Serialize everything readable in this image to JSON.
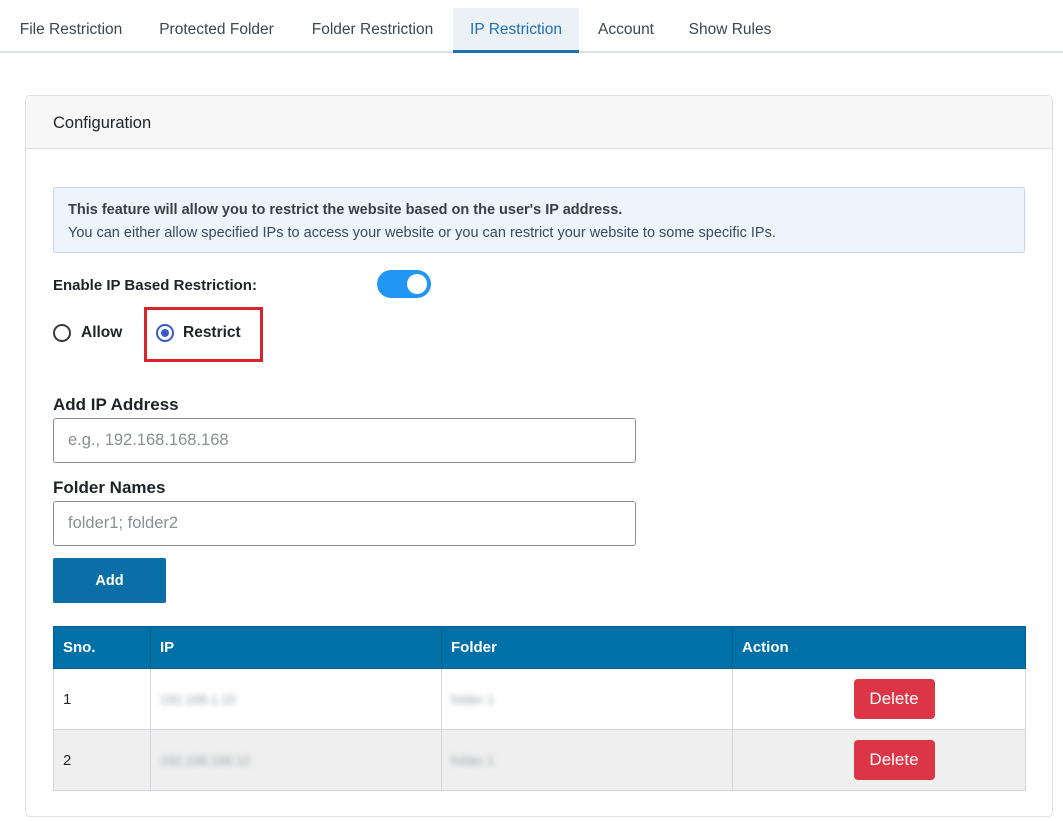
{
  "tabs": [
    {
      "label": "File Restriction",
      "active": false
    },
    {
      "label": "Protected Folder",
      "active": false
    },
    {
      "label": "Folder Restriction",
      "active": false
    },
    {
      "label": "IP Restriction",
      "active": true
    },
    {
      "label": "Account",
      "active": false
    },
    {
      "label": "Show Rules",
      "active": false
    }
  ],
  "card": {
    "title": "Configuration"
  },
  "alert": {
    "heading": "This feature will allow you to restrict the website based on the user's IP address.",
    "body": "You can either allow specified IPs to access your website or you can restrict your website to some specific IPs."
  },
  "enable": {
    "label": "Enable IP Based Restriction:",
    "enabled": true
  },
  "mode": {
    "options": [
      "Allow",
      "Restrict"
    ],
    "selected": "Restrict"
  },
  "form": {
    "ip_label": "Add IP Address",
    "ip_placeholder": "e.g., 192.168.168.168",
    "ip_value": "",
    "folder_label": "Folder Names",
    "folder_placeholder": "folder1; folder2",
    "folder_value": "",
    "add_label": "Add"
  },
  "table": {
    "headers": [
      "Sno.",
      "IP",
      "Folder",
      "Action"
    ],
    "rows": [
      {
        "sno": "1",
        "ip": "192.168.1.10",
        "folder": "folder 1",
        "action": "Delete"
      },
      {
        "sno": "2",
        "ip": "192.168.168.12",
        "folder": "folder 1",
        "action": "Delete"
      }
    ]
  },
  "colors": {
    "accent": "#1f6fb3",
    "table_header": "#0070a8",
    "toggle_on": "#2196f3",
    "delete": "#dc3545",
    "highlight": "#d9232d"
  }
}
